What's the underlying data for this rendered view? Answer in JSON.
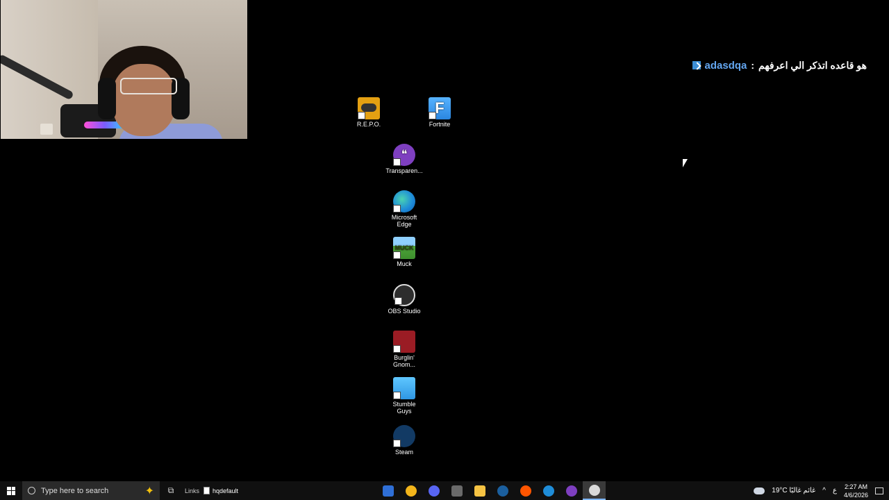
{
  "chat": {
    "username": "adasdqa",
    "separator": ":",
    "message": "هو قاعده اتذكر الي اعرفهم"
  },
  "desktop_icons": [
    {
      "id": "repo",
      "label": "R.E.P.O."
    },
    {
      "id": "fortnite",
      "label": "Fortnite",
      "glyph": "F"
    },
    {
      "id": "transparent",
      "label": "Transparen...",
      "glyph": "❝"
    },
    {
      "id": "edge",
      "label_line1": "Microsoft",
      "label_line2": "Edge"
    },
    {
      "id": "muck",
      "label": "Muck",
      "glyph": "MUCK"
    },
    {
      "id": "obs",
      "label": "OBS Studio"
    },
    {
      "id": "burglin",
      "label_line1": "Burglin'",
      "label_line2": "Gnom..."
    },
    {
      "id": "stumble",
      "label_line1": "Stumble",
      "label_line2": "Guys"
    },
    {
      "id": "steam",
      "label": "Steam"
    }
  ],
  "taskbar": {
    "search_placeholder": "Type here to search",
    "links_label": "Links",
    "file_label": "hqdefault",
    "pinned": [
      {
        "name": "outlook",
        "color": "#2f6fd6"
      },
      {
        "name": "discord-yellow",
        "color": "#f3b51b"
      },
      {
        "name": "discord",
        "color": "#5865f2"
      },
      {
        "name": "photo",
        "color": "#6a6a6a"
      },
      {
        "name": "file-explorer",
        "color": "#f6c343"
      },
      {
        "name": "steam",
        "color": "#1b5f9e"
      },
      {
        "name": "soundcloud",
        "color": "#ff5500"
      },
      {
        "name": "edge",
        "color": "#1f8dd8"
      },
      {
        "name": "transparent",
        "color": "#7e3fc0"
      },
      {
        "name": "obs",
        "color": "#d9d9d9"
      }
    ],
    "weather": "19°C  غائم غالبًا",
    "language": "ع",
    "time": "2:27 AM",
    "date": "4/6/2026"
  },
  "colors": {
    "desktop_bg": "#000000",
    "taskbar_bg": "#101010",
    "chat_user": "#63a6f0"
  }
}
